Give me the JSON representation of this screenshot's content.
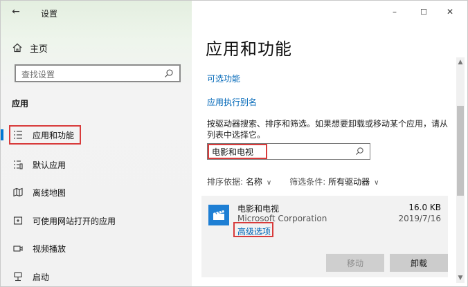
{
  "window": {
    "title": "设置",
    "controls": {
      "minimize": "–",
      "maximize": "☐",
      "close": "✕"
    }
  },
  "sidebar": {
    "home_label": "主页",
    "search_placeholder": "查找设置",
    "section_title": "应用",
    "items": [
      {
        "label": "应用和功能",
        "icon": "apps-features-icon",
        "active": true
      },
      {
        "label": "默认应用",
        "icon": "default-apps-icon",
        "active": false
      },
      {
        "label": "离线地图",
        "icon": "offline-maps-icon",
        "active": false
      },
      {
        "label": "可使用网站打开的应用",
        "icon": "apps-for-websites-icon",
        "active": false
      },
      {
        "label": "视频播放",
        "icon": "video-playback-icon",
        "active": false
      },
      {
        "label": "启动",
        "icon": "startup-icon",
        "active": false
      }
    ]
  },
  "main": {
    "title": "应用和功能",
    "link_optional_features": "可选功能",
    "link_app_execution_aliases": "应用执行别名",
    "description": "按驱动器搜索、排序和筛选。如果想要卸载或移动某个应用，请从列表中选择它。",
    "filter_value": "电影和电视",
    "sort_label": "排序依据:",
    "sort_value": "名称",
    "filter_label": "筛选条件:",
    "filter_drive_value": "所有驱动器"
  },
  "app_card": {
    "name": "电影和电视",
    "publisher": "Microsoft Corporation",
    "advanced_options": "高级选项",
    "size": "16.0 KB",
    "date": "2019/7/16",
    "move_button": "移动",
    "uninstall_button": "卸载"
  },
  "colors": {
    "accent": "#0078d4",
    "link": "#0067b8",
    "highlight": "#d83b3b",
    "app_tile": "#1e7fd4"
  }
}
